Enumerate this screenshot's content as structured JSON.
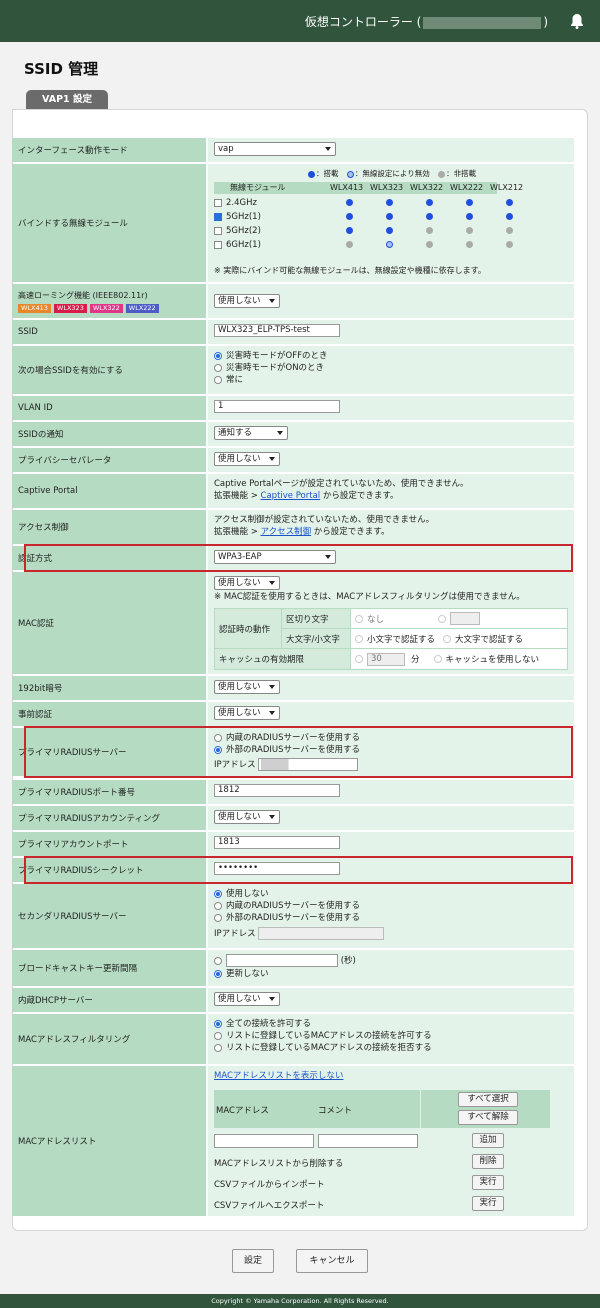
{
  "header": {
    "controller_prefix": "仮想コントローラー (",
    "controller_suffix": ")"
  },
  "page": {
    "title": "SSID 管理",
    "tab": "VAP1 設定"
  },
  "iface": {
    "label": "インターフェース動作モード",
    "value": "vap"
  },
  "bind": {
    "label": "バインドする無線モジュール",
    "legend_on": "：搭載",
    "legend_partial": "：無線設定により無効",
    "legend_off": "：非搭載",
    "col_header": "無線モジュール",
    "models": [
      "WLX413",
      "WLX323",
      "WLX322",
      "WLX222",
      "WLX212"
    ],
    "bands": [
      "2.4GHz",
      "5GHz(1)",
      "5GHz(2)",
      "6GHz(1)"
    ],
    "note": "※ 実際にバインド可能な無線モジュールは、無線設定や機種に依存します。"
  },
  "roaming": {
    "label": "高速ローミング機能 (IEEE802.11r)",
    "badges": [
      "WLX413",
      "WLX323",
      "WLX322",
      "WLX222"
    ],
    "badge_colors": [
      "#e8862a",
      "#d91b4b",
      "#e0368a",
      "#4d5cc8"
    ],
    "value": "使用しない"
  },
  "ssid": {
    "label": "SSID",
    "value": "WLX323_ELP-TPS-test"
  },
  "enable_when": {
    "label": "次の場合SSIDを有効にする",
    "options": [
      "災害時モードがOFFのとき",
      "災害時モードがONのとき",
      "常に"
    ]
  },
  "vlan": {
    "label": "VLAN ID",
    "value": "1"
  },
  "notify": {
    "label": "SSIDの通知",
    "value": "通知する"
  },
  "privacy": {
    "label": "プライバシーセパレータ",
    "value": "使用しない"
  },
  "captive": {
    "label": "Captive Portal",
    "line1": "Captive Portalページが設定されていないため、使用できません。",
    "path": "拡張機能 > ",
    "link": "Captive Portal",
    "suffix": " から設定できます。"
  },
  "acl": {
    "label": "アクセス制御",
    "line1": "アクセス制御が設定されていないため、使用できません。",
    "path": "拡張機能 > ",
    "link": "アクセス制御",
    "suffix": " から設定できます。"
  },
  "auth": {
    "label": "認証方式",
    "value": "WPA3-EAP"
  },
  "mac_auth": {
    "label": "MAC認証",
    "value": "使用しない",
    "note": "※ MAC認証を使用するときは、MACアドレスフィルタリングは使用できません。",
    "op_label": "認証時の動作",
    "delim_label": "区切り文字",
    "delim_none": "なし",
    "case_label": "大文字/小文字",
    "case_lower": "小文字で認証する",
    "case_upper": "大文字で認証する",
    "cache_label": "キャッシュの有効期限",
    "cache_value": "30",
    "cache_unit": "分",
    "cache_none": "キャッシュを使用しない"
  },
  "crypto192": {
    "label": "192bit暗号",
    "value": "使用しない"
  },
  "preauth": {
    "label": "事前認証",
    "value": "使用しない"
  },
  "primary_radius": {
    "label": "プライマリRADIUSサーバー",
    "options": [
      "内蔵のRADIUSサーバーを使用する",
      "外部のRADIUSサーバーを使用する"
    ],
    "ip_label": "IPアドレス"
  },
  "primary_port": {
    "label": "プライマリRADIUSポート番号",
    "value": "1812"
  },
  "primary_acct": {
    "label": "プライマリRADIUSアカウンティング",
    "value": "使用しない"
  },
  "primary_acct_port": {
    "label": "プライマリアカウントポート",
    "value": "1813"
  },
  "primary_secret": {
    "label": "プライマリRADIUSシークレット",
    "value": "••••••••"
  },
  "secondary_radius": {
    "label": "セカンダリRADIUSサーバー",
    "options": [
      "使用しない",
      "内蔵のRADIUSサーバーを使用する",
      "外部のRADIUSサーバーを使用する"
    ],
    "ip_label": "IPアドレス"
  },
  "broadcast_key": {
    "label": "ブロードキャストキー更新間隔",
    "unit": "(秒)",
    "no_update": "更新しない"
  },
  "dhcp": {
    "label": "内蔵DHCPサーバー",
    "value": "使用しない"
  },
  "mac_filter": {
    "label": "MACアドレスフィルタリング",
    "options": [
      "全ての接続を許可する",
      "リストに登録しているMACアドレスの接続を許可する",
      "リストに登録しているMACアドレスの接続を拒否する"
    ]
  },
  "mac_list": {
    "label": "MACアドレスリスト",
    "show_link": "MACアドレスリストを表示しない",
    "col_mac": "MACアドレス",
    "col_comment": "コメント",
    "select_all": "すべて選択",
    "deselect_all": "すべて解除",
    "add": "追加",
    "delete_label": "MACアドレスリストから削除する",
    "delete_btn": "削除",
    "import_label": "CSVファイルからインポート",
    "import_btn": "実行",
    "export_label": "CSVファイルへエクスポート",
    "export_btn": "実行"
  },
  "actions": {
    "save": "設定",
    "cancel": "キャンセル"
  },
  "footer": {
    "copyright": "Copyright © Yamaha Corporation. All Rights Reserved."
  }
}
